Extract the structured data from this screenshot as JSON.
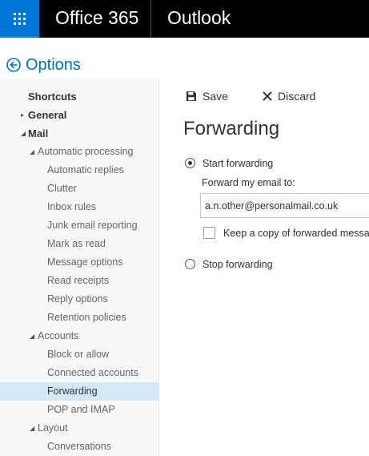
{
  "header": {
    "brand": "Office 365",
    "app": "Outlook",
    "waffle_icon": "app-launcher-icon",
    "accent_color": "#0078d7",
    "bar_color": "#000000"
  },
  "options": {
    "title": "Options",
    "back_icon": "back-arrow-icon"
  },
  "sidebar": {
    "items": [
      {
        "label": "Shortcuts",
        "level": 0,
        "arrow": ""
      },
      {
        "label": "General",
        "level": 0,
        "arrow": "▸"
      },
      {
        "label": "Mail",
        "level": 0,
        "arrow": "◢"
      },
      {
        "label": "Automatic processing",
        "level": 1,
        "arrow": "◢"
      },
      {
        "label": "Automatic replies",
        "level": 2,
        "arrow": ""
      },
      {
        "label": "Clutter",
        "level": 2,
        "arrow": ""
      },
      {
        "label": "Inbox rules",
        "level": 2,
        "arrow": ""
      },
      {
        "label": "Junk email reporting",
        "level": 2,
        "arrow": ""
      },
      {
        "label": "Mark as read",
        "level": 2,
        "arrow": ""
      },
      {
        "label": "Message options",
        "level": 2,
        "arrow": ""
      },
      {
        "label": "Read receipts",
        "level": 2,
        "arrow": ""
      },
      {
        "label": "Reply options",
        "level": 2,
        "arrow": ""
      },
      {
        "label": "Retention policies",
        "level": 2,
        "arrow": ""
      },
      {
        "label": "Accounts",
        "level": 1,
        "arrow": "◢"
      },
      {
        "label": "Block or allow",
        "level": 2,
        "arrow": ""
      },
      {
        "label": "Connected accounts",
        "level": 2,
        "arrow": ""
      },
      {
        "label": "Forwarding",
        "level": 2,
        "arrow": "",
        "selected": true
      },
      {
        "label": "POP and IMAP",
        "level": 2,
        "arrow": ""
      },
      {
        "label": "Layout",
        "level": 1,
        "arrow": "◢"
      },
      {
        "label": "Conversations",
        "level": 2,
        "arrow": ""
      }
    ]
  },
  "toolbar": {
    "save_label": "Save",
    "save_icon": "floppy-disk-icon",
    "discard_label": "Discard",
    "discard_icon": "close-x-icon"
  },
  "main": {
    "title": "Forwarding",
    "start_forwarding_label": "Start forwarding",
    "start_forwarding_selected": true,
    "forward_to_label": "Forward my email to:",
    "forward_email_value": "a.n.other@personalmail.co.uk",
    "keep_copy_label": "Keep a copy of forwarded message",
    "keep_copy_checked": false,
    "stop_forwarding_label": "Stop forwarding",
    "stop_forwarding_selected": false
  }
}
